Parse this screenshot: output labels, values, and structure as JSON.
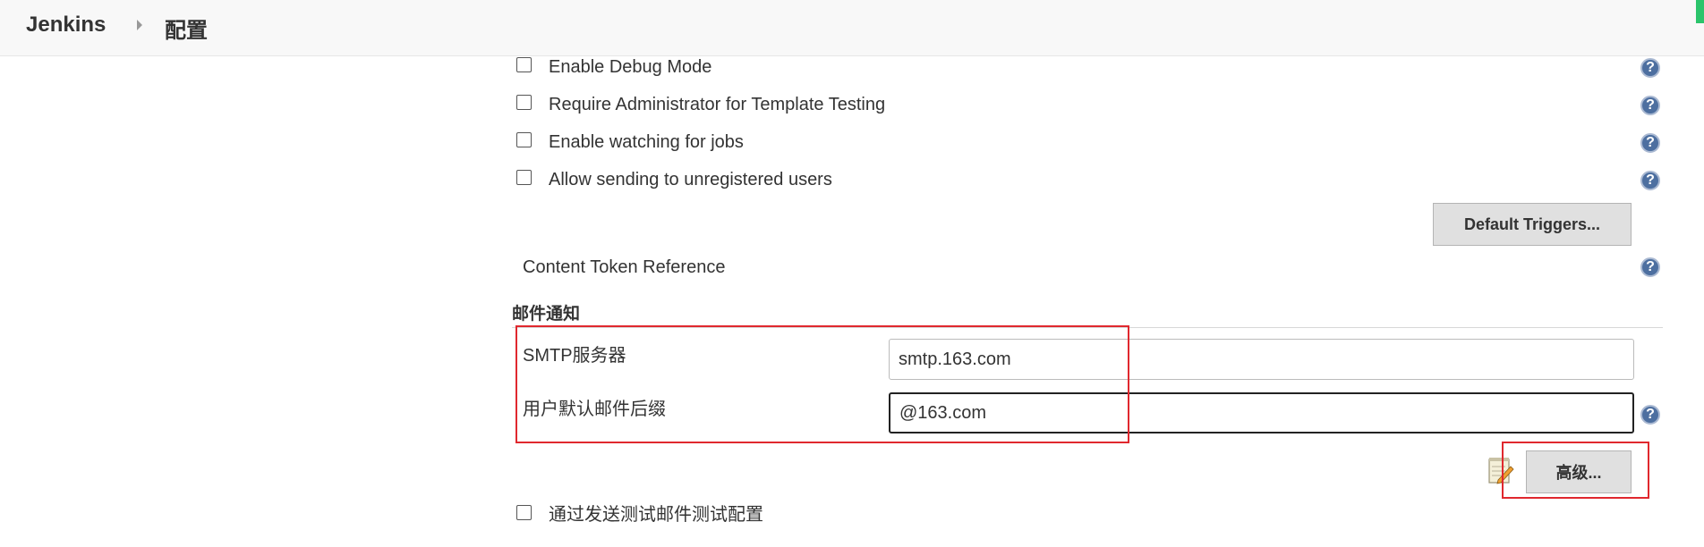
{
  "header": {
    "brand": "Jenkins",
    "breadcrumb": "配置"
  },
  "options": [
    {
      "label": "Enable Debug Mode",
      "checked": false
    },
    {
      "label": "Require Administrator for Template Testing",
      "checked": false
    },
    {
      "label": "Enable watching for jobs",
      "checked": false
    },
    {
      "label": "Allow sending to unregistered users",
      "checked": false
    }
  ],
  "buttons": {
    "default_triggers": "Default Triggers...",
    "advanced": "高级..."
  },
  "content_token": "Content Token Reference",
  "mail": {
    "section_title": "邮件通知",
    "smtp_label": "SMTP服务器",
    "smtp_value": "smtp.163.com",
    "suffix_label": "用户默认邮件后缀",
    "suffix_value": "@163.com",
    "test_label": "通过发送测试邮件测试配置",
    "test_checked": false
  },
  "help_icon": "?",
  "colors": {
    "highlight": "#e0282e",
    "help": "#4d6fa0"
  }
}
